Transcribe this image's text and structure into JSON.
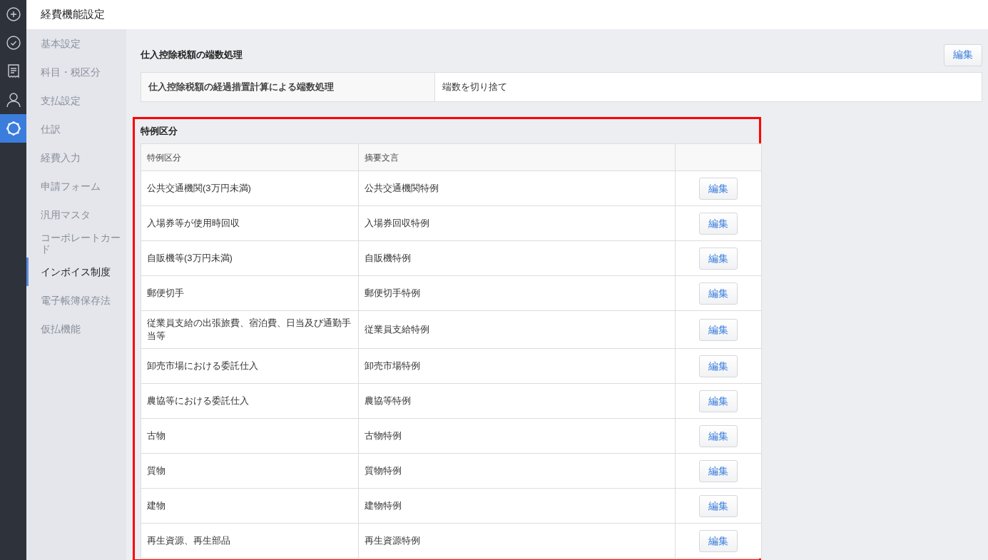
{
  "rail": [
    {
      "kind": "plus",
      "selected": false
    },
    {
      "kind": "check",
      "selected": false
    },
    {
      "kind": "receipt",
      "selected": false
    },
    {
      "kind": "person",
      "selected": false
    },
    {
      "kind": "gear",
      "selected": true
    }
  ],
  "header": {
    "title": "経費機能設定"
  },
  "sidebar": {
    "items": [
      {
        "label": "基本設定",
        "selected": false
      },
      {
        "label": "科目・税区分",
        "selected": false
      },
      {
        "label": "支払設定",
        "selected": false
      },
      {
        "label": "仕訳",
        "selected": false
      },
      {
        "label": "経費入力",
        "selected": false
      },
      {
        "label": "申請フォーム",
        "selected": false
      },
      {
        "label": "汎用マスタ",
        "selected": false
      },
      {
        "label": "コーポレートカード",
        "selected": false
      },
      {
        "label": "インボイス制度",
        "selected": true
      },
      {
        "label": "電子帳簿保存法",
        "selected": false
      },
      {
        "label": "仮払機能",
        "selected": false
      }
    ]
  },
  "rounding": {
    "title": "仕入控除税額の端数処理",
    "edit_button": "編集",
    "rows": [
      {
        "label": "仕入控除税額の経過措置計算による端数処理",
        "value": "端数を切り捨て"
      }
    ]
  },
  "special": {
    "title": "特例区分",
    "columns": [
      "特例区分",
      "摘要文言"
    ],
    "rows": [
      {
        "category": "公共交通機関(3万円未満)",
        "summary": "公共交通機関特例",
        "button": "編集"
      },
      {
        "category": "入場券等が使用時回収",
        "summary": "入場券回収特例",
        "button": "編集"
      },
      {
        "category": "自販機等(3万円未満)",
        "summary": "自販機特例",
        "button": "編集"
      },
      {
        "category": "郵便切手",
        "summary": "郵便切手特例",
        "button": "編集"
      },
      {
        "category": "従業員支給の出張旅費、宿泊費、日当及び通勤手当等",
        "summary": "従業員支給特例",
        "button": "編集"
      },
      {
        "category": "卸売市場における委託仕入",
        "summary": "卸売市場特例",
        "button": "編集"
      },
      {
        "category": "農協等における委託仕入",
        "summary": "農協等特例",
        "button": "編集"
      },
      {
        "category": "古物",
        "summary": "古物特例",
        "button": "編集"
      },
      {
        "category": "質物",
        "summary": "質物特例",
        "button": "編集"
      },
      {
        "category": "建物",
        "summary": "建物特例",
        "button": "編集"
      },
      {
        "category": "再生資源、再生部品",
        "summary": "再生資源特例",
        "button": "編集"
      }
    ]
  }
}
